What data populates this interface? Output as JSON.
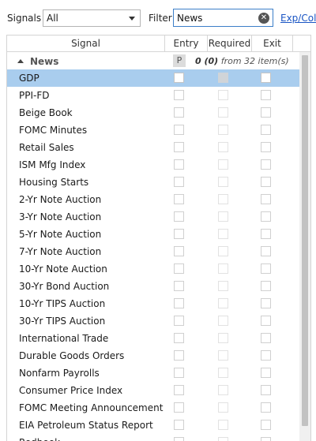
{
  "toolbar": {
    "signals_label": "Signals",
    "signals_value": "All",
    "filter_label": "Filter",
    "filter_value": "News",
    "exp_link": "Exp/Col"
  },
  "columns": {
    "signal": "Signal",
    "entry": "Entry",
    "required": "Required",
    "exit": "Exit"
  },
  "group": {
    "name": "News",
    "badge": "P",
    "count": "0 (0)",
    "count_suffix": "from 32 item(s)"
  },
  "rows": [
    {
      "name": "GDP",
      "selected": true
    },
    {
      "name": "PPI-FD"
    },
    {
      "name": "Beige Book"
    },
    {
      "name": "FOMC Minutes"
    },
    {
      "name": "Retail Sales"
    },
    {
      "name": "ISM Mfg Index"
    },
    {
      "name": "Housing Starts"
    },
    {
      "name": "2-Yr Note Auction"
    },
    {
      "name": "3-Yr Note Auction"
    },
    {
      "name": "5-Yr Note Auction"
    },
    {
      "name": "7-Yr Note Auction"
    },
    {
      "name": "10-Yr Note Auction"
    },
    {
      "name": "30-Yr Bond Auction"
    },
    {
      "name": "10-Yr TIPS Auction"
    },
    {
      "name": "30-Yr TIPS Auction"
    },
    {
      "name": "International Trade"
    },
    {
      "name": "Durable Goods Orders"
    },
    {
      "name": "Nonfarm Payrolls"
    },
    {
      "name": "Consumer Price Index"
    },
    {
      "name": "FOMC Meeting Announcement"
    },
    {
      "name": "EIA Petroleum Status Report"
    },
    {
      "name": "Redbook"
    }
  ],
  "icons": {
    "clear": "clear-filter-icon",
    "dropdown": "chevron-down-icon",
    "collapse": "collapse-triangle-icon"
  },
  "colors": {
    "selection": "#a9cdee",
    "link": "#1a55c4",
    "focus_border": "#3c7fc8"
  }
}
